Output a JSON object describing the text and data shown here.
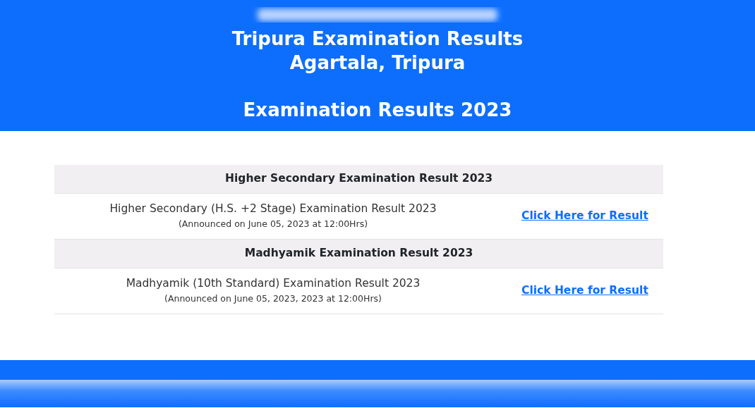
{
  "header": {
    "title_lines": [
      "Tripura Examination Results",
      "Agartala, Tripura"
    ],
    "subtitle": "Examination Results 2023"
  },
  "sections": [
    {
      "heading": "Higher Secondary Examination Result 2023",
      "result": {
        "name": "Higher Secondary (H.S. +2 Stage) Examination Result 2023",
        "note": "(Announced on June 05, 2023 at 12:00Hrs)",
        "link": "Click Here for Result"
      }
    },
    {
      "heading": "Madhyamik Examination Result 2023",
      "result": {
        "name": "Madhyamik (10th Standard) Examination Result 2023",
        "note": "(Announced on June 05, 2023, 2023 at 12:00Hrs)",
        "link": "Click Here for Result"
      }
    }
  ]
}
